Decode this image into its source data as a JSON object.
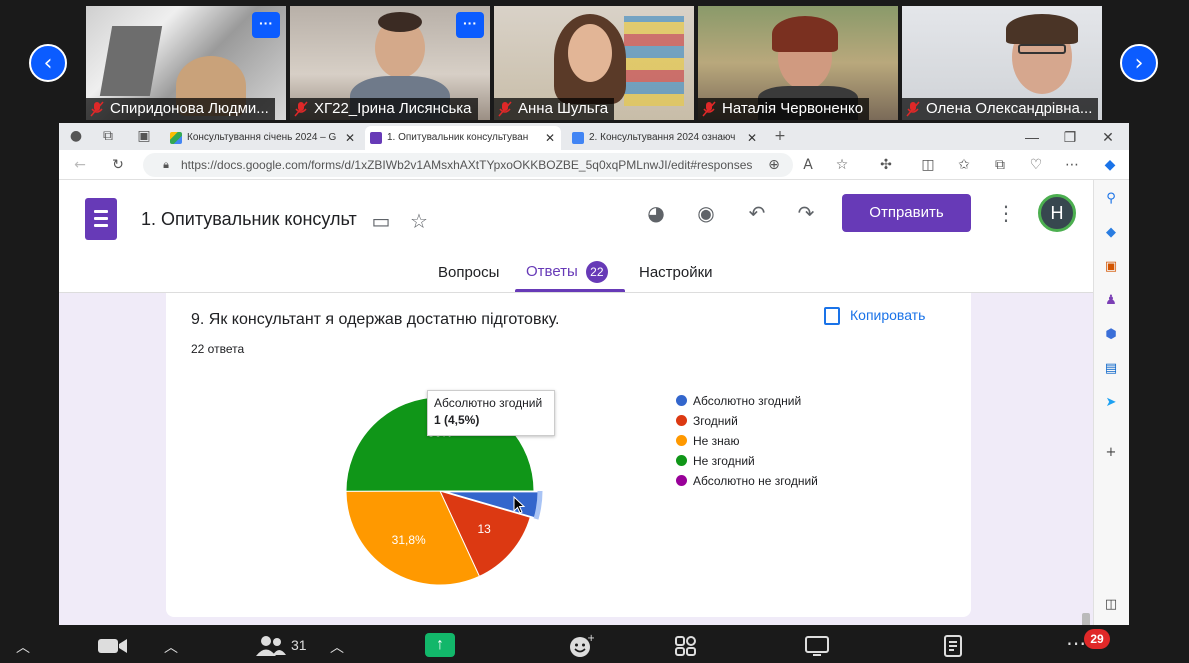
{
  "zoom": {
    "participants": [
      {
        "name": "Спиридонова Людми...",
        "has_more_button": true
      },
      {
        "name": "ХГ22_Ірина Лисянська",
        "has_more_button": true
      },
      {
        "name": "Анна Шульга",
        "has_more_button": false
      },
      {
        "name": "Наталія Червоненко",
        "has_more_button": false
      },
      {
        "name": "Олена Олександрівна...",
        "has_more_button": false
      }
    ],
    "more_label": "···",
    "prev_icon": "chevron-left-icon",
    "next_icon": "chevron-right-icon",
    "toolbar": {
      "participants_count": "31",
      "notifications_badge": "29"
    }
  },
  "browser": {
    "tabs": [
      {
        "label": "Консультування січень 2024 – G",
        "icon": "google-drive-icon",
        "active": false
      },
      {
        "label": "1. Опитувальник консультуван",
        "icon": "google-forms-icon",
        "active": true
      },
      {
        "label": "2. Консультування 2024 ознаюч",
        "icon": "google-docs-icon",
        "active": false
      }
    ],
    "new_tab_label": "+",
    "url": "https://docs.google.com/forms/d/1xZBIWb2v1AMsxhAXtTYpxoOKKBOZBE_5q0xqPMLnwJI/edit#responses"
  },
  "forms": {
    "doc_title": "1. Опитувальник консульт",
    "send_label": "Отправить",
    "avatar_letter": "H",
    "tabs": {
      "questions": "Вопросы",
      "responses": "Ответы",
      "responses_count": "22",
      "settings": "Настройки"
    },
    "question": {
      "title": "9. Як консультант я одержав достатню підготовку.",
      "response_count": "22 ответа",
      "copy_label": "Копировать"
    },
    "tooltip": {
      "label": "Абсолютно згодний",
      "value": "1 (4,5%)"
    },
    "accent": "#673ab7"
  },
  "chart_data": {
    "type": "pie",
    "categories": [
      "Абсолютно згодний",
      "Згодний",
      "Не знаю",
      "Не згодний",
      "Абсолютно не згодний"
    ],
    "values": [
      4.5,
      13.6,
      31.8,
      50,
      0
    ],
    "counts": [
      1,
      3,
      7,
      11,
      0
    ],
    "colors": [
      "#3366cc",
      "#dc3912",
      "#ff9900",
      "#109618",
      "#990099"
    ],
    "data_labels": [
      "",
      "13",
      "31,8%",
      "50%",
      ""
    ],
    "legend_position": "right",
    "highlighted": "Абсолютно згодний"
  }
}
